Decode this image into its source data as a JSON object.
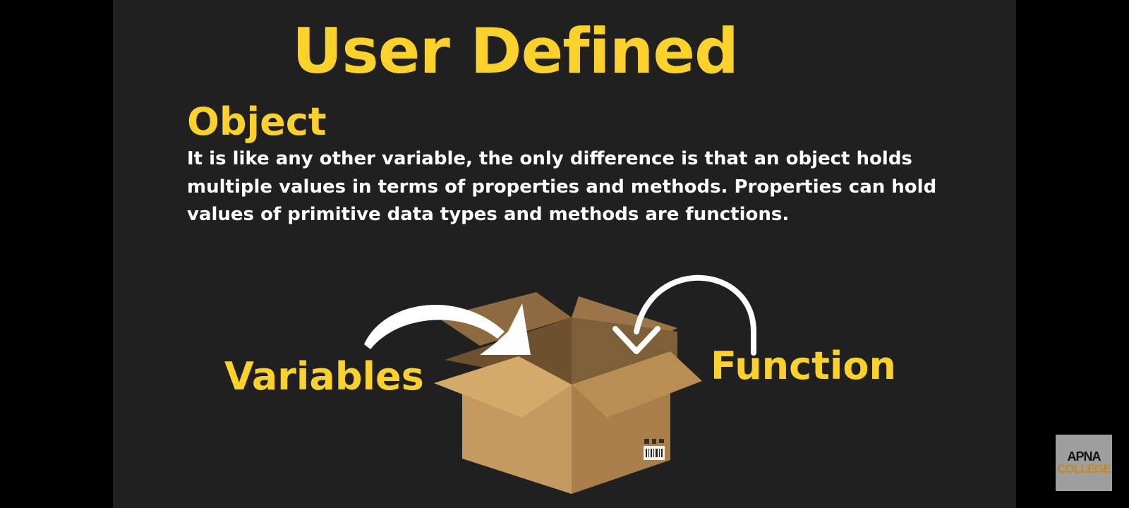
{
  "slide": {
    "title": "User Defined",
    "subtitle": "Object",
    "description": "It is like any other variable, the only difference is that an object holds multiple values in terms of properties and methods. Properties can hold values of primitive data types and methods are functions."
  },
  "illustration": {
    "left_label": "Variables",
    "right_label": "Function",
    "icons": [
      "open-box-icon",
      "curved-arrow-icon",
      "loop-arrow-icon"
    ]
  },
  "logo": {
    "line1": "APNA",
    "line2": "COLLEGE"
  },
  "colors": {
    "background": "#202020",
    "accent": "#fcd12a",
    "text": "#ffffff"
  }
}
